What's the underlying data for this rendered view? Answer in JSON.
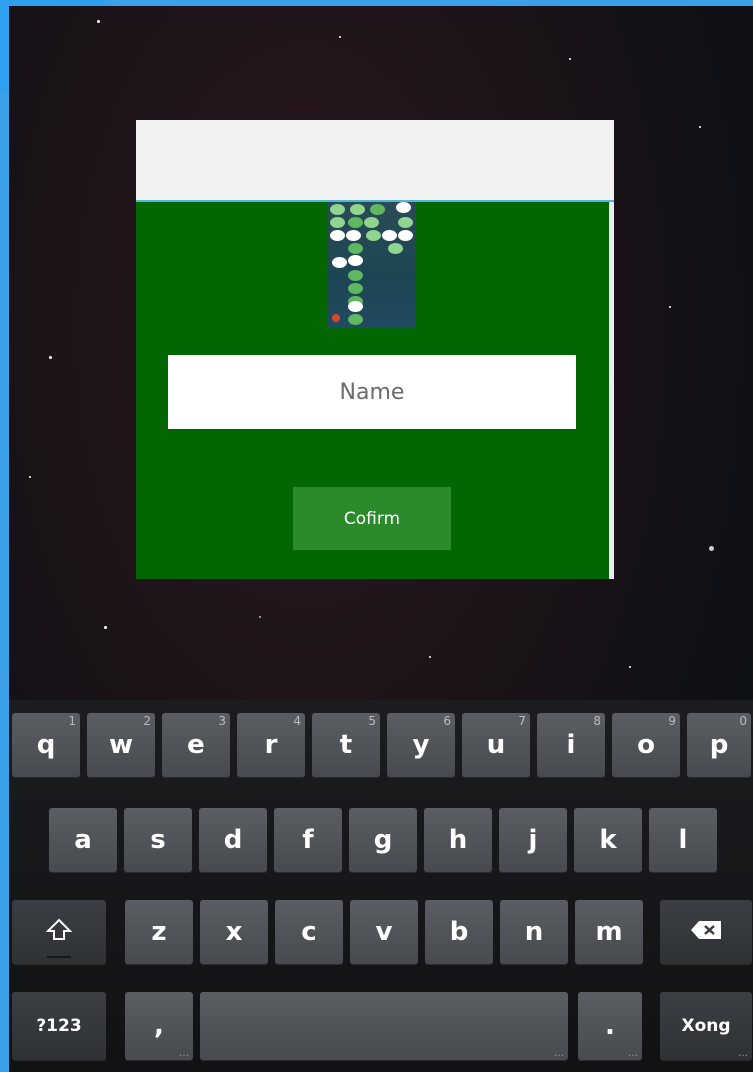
{
  "dialog": {
    "name_placeholder": "Name",
    "confirm_label": "Cofirm"
  },
  "keyboard": {
    "row1": [
      {
        "label": "q",
        "num": "1"
      },
      {
        "label": "w",
        "num": "2"
      },
      {
        "label": "e",
        "num": "3"
      },
      {
        "label": "r",
        "num": "4"
      },
      {
        "label": "t",
        "num": "5"
      },
      {
        "label": "y",
        "num": "6"
      },
      {
        "label": "u",
        "num": "7"
      },
      {
        "label": "i",
        "num": "8"
      },
      {
        "label": "o",
        "num": "9"
      },
      {
        "label": "p",
        "num": "0"
      }
    ],
    "row2": [
      "a",
      "s",
      "d",
      "f",
      "g",
      "h",
      "j",
      "k",
      "l"
    ],
    "row3": [
      "z",
      "x",
      "c",
      "v",
      "b",
      "n",
      "m"
    ],
    "shift_icon": "shift-icon",
    "backspace_icon": "backspace-icon",
    "symbols_label": "?123",
    "comma_label": ",",
    "period_label": ".",
    "done_label": "Xong"
  },
  "colors": {
    "accent": "#3aa0e8",
    "dialog_body": "#026702",
    "confirm_button": "#2b8a2b"
  }
}
